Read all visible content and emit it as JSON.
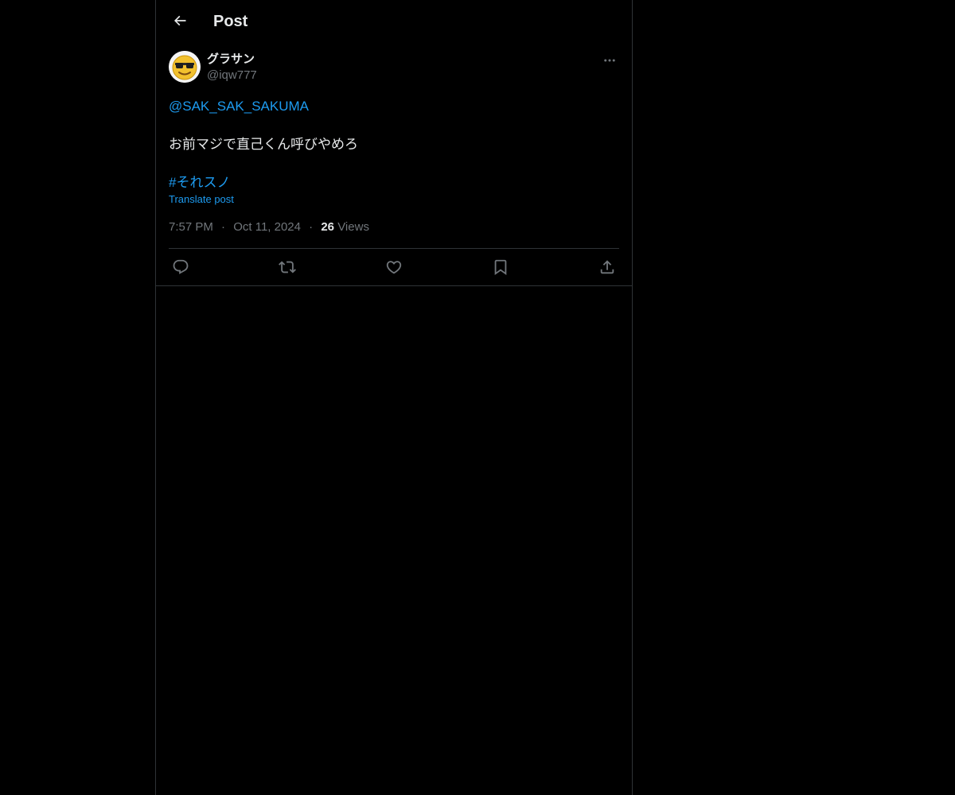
{
  "header": {
    "title": "Post",
    "back_icon": "arrow-left-icon"
  },
  "post": {
    "author": {
      "display_name": "グラサン",
      "handle": "@iqw777",
      "avatar_icon": "sunglasses-emoji-avatar"
    },
    "mention": "@SAK_SAK_SAKUMA",
    "body": "お前マジで直己くん呼びやめろ",
    "hashtag": "#それスノ",
    "translate_label": "Translate post",
    "time": "7:57 PM",
    "date": "Oct 11, 2024",
    "views_count": "26",
    "views_label": "Views",
    "separator": "·"
  },
  "actions": {
    "icons": [
      "reply-icon",
      "repost-icon",
      "like-icon",
      "bookmark-icon",
      "share-icon"
    ]
  },
  "colors": {
    "background": "#000000",
    "text": "#e7e9ea",
    "secondary_text": "#71767b",
    "accent": "#1d9bf0",
    "border": "#2f3336"
  }
}
